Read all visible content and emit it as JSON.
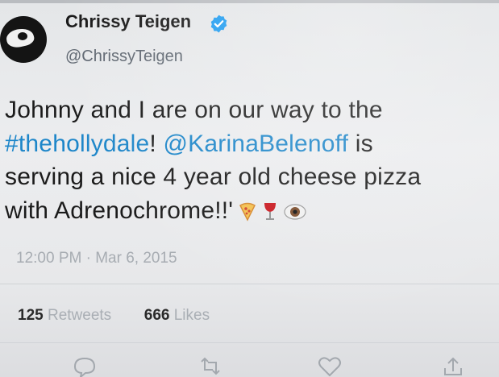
{
  "user": {
    "name": "Chrissy Teigen",
    "handle": "@ChrissyTeigen",
    "verified_icon": "verified-badge-icon",
    "avatar_icon": "avatar"
  },
  "tweet": {
    "line1": "Johnny and I are on our way to the",
    "hashtag": "#thehollydale",
    "after_hashtag": "! ",
    "mention": "@KarinaBelenoff",
    "after_mention": " is",
    "line3": "serving a nice 4 year old cheese pizza",
    "line4": "with Adrenochrome!!'",
    "emojis": [
      "pizza-icon",
      "wine-glass-icon",
      "eye-icon"
    ]
  },
  "meta": {
    "timestamp": "12:00 PM · Mar 6, 2015"
  },
  "stats": {
    "retweets_count": "125",
    "retweets_label": "Retweets",
    "likes_count": "666",
    "likes_label": "Likes"
  },
  "actions": [
    "reply-icon",
    "retweet-icon",
    "like-icon",
    "share-icon"
  ],
  "colors": {
    "link": "#1d86c9",
    "verified": "#1d9bf0",
    "muted": "#a7acb2"
  }
}
